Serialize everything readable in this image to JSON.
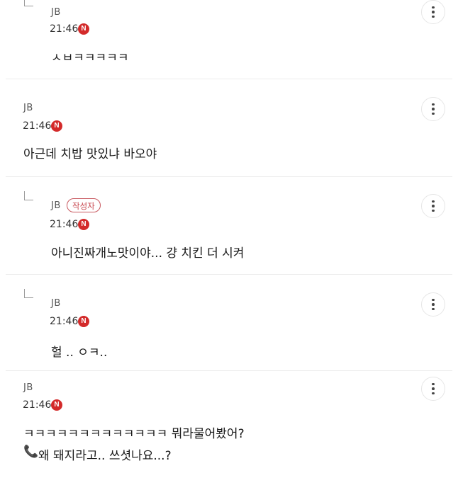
{
  "comments": [
    {
      "author": "JB",
      "time": "21:46",
      "new_badge": "N",
      "text": "ㅅㅂㅋㅋㅋㅋㅋ",
      "reply": true
    },
    {
      "author": "JB",
      "time": "21:46",
      "new_badge": "N",
      "text": "아근데 치밥 맛있냐 바오야",
      "reply": false
    },
    {
      "author": "JB",
      "writer_badge": "작성자",
      "time": "21:46",
      "new_badge": "N",
      "text": "아니진짜개노맛이야... 걍 치킨 더 시켜",
      "reply": true
    },
    {
      "author": "JB",
      "time": "21:46",
      "new_badge": "N",
      "text": "헐 .. ㅇㅋ..",
      "reply": true
    },
    {
      "author": "JB",
      "time": "21:46",
      "new_badge": "N",
      "text": "ㅋㅋㅋㅋㅋㅋㅋㅋㅋㅋㅋㅋㅋ 뭐라물어봤어?",
      "text_line2": "왜 돼지라고.. 쓰셧나요...?",
      "reply": false
    }
  ],
  "icons": {
    "more": "more-vertical-icon",
    "reply": "reply-arrow-icon",
    "phone": "phone-icon"
  },
  "colors": {
    "new_badge": "#d32a2a",
    "writer_badge": "#c8474f",
    "divider": "#ececec"
  }
}
